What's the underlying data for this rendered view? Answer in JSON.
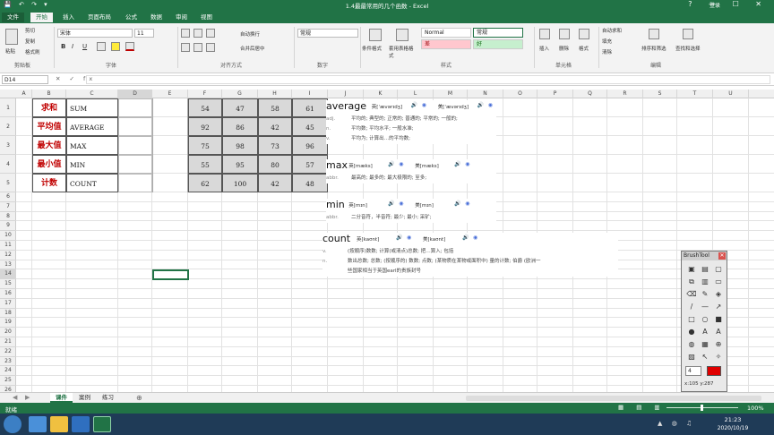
{
  "window": {
    "title": "1.4最最常用的几个函数 - Excel",
    "user": "登录",
    "controls": [
      "?",
      "—",
      "☐",
      "✕"
    ]
  },
  "quick_access": [
    "💾",
    "↶",
    "↷",
    "▾"
  ],
  "ribbon_tabs": [
    "文件",
    "开始",
    "插入",
    "页面布局",
    "公式",
    "数据",
    "审阅",
    "视图"
  ],
  "ribbon": {
    "clipboard": {
      "paste": "粘贴",
      "cut": "剪切",
      "copy": "复制",
      "format_painter": "格式刷",
      "label": "剪贴板"
    },
    "font": {
      "name": "宋体",
      "size": "11",
      "label": "字体",
      "bold": "B",
      "italic": "I",
      "underline": "U"
    },
    "alignment": {
      "wrap": "自动换行",
      "merge": "合并后居中",
      "label": "对齐方式"
    },
    "number": {
      "format": "常规",
      "label": "数字"
    },
    "styles": {
      "conditional": "条件格式",
      "table": "套用表格格式",
      "normal": "Normal",
      "general": "常规",
      "bad": "差",
      "good": "好",
      "label": "样式"
    },
    "cells": {
      "insert": "插入",
      "delete": "删除",
      "format": "格式",
      "label": "单元格"
    },
    "editing": {
      "autosum": "自动求和",
      "fill": "填充",
      "clear": "清除",
      "sort": "排序和筛选",
      "find": "查找和选择",
      "label": "编辑"
    }
  },
  "namebox": "D14",
  "fx": "✕ ✓ fx",
  "columns": [
    "A",
    "B",
    "C",
    "D",
    "E",
    "F",
    "G",
    "H",
    "I",
    "J",
    "K",
    "L",
    "M",
    "N",
    "O",
    "P",
    "Q",
    "R",
    "S",
    "T",
    "U"
  ],
  "rows": [
    "1",
    "2",
    "3",
    "4",
    "5",
    "6",
    "7",
    "8",
    "9",
    "10",
    "11",
    "12",
    "13",
    "14",
    "15",
    "16",
    "17",
    "18",
    "19",
    "20",
    "21",
    "22",
    "23",
    "24",
    "25",
    "26",
    "27",
    "28",
    "29"
  ],
  "table": [
    {
      "label": "求和",
      "func": "SUM",
      "nums": [
        "54",
        "47",
        "58",
        "61"
      ]
    },
    {
      "label": "平均值",
      "func": "AVERAGE",
      "nums": [
        "92",
        "86",
        "42",
        "45"
      ]
    },
    {
      "label": "最大值",
      "func": "MAX",
      "nums": [
        "75",
        "98",
        "73",
        "96"
      ]
    },
    {
      "label": "最小值",
      "func": "MIN",
      "nums": [
        "55",
        "95",
        "80",
        "57"
      ]
    },
    {
      "label": "计数",
      "func": "COUNT",
      "nums": [
        "62",
        "100",
        "42",
        "48"
      ]
    }
  ],
  "dict": [
    {
      "word": "average",
      "uk": "英[ˈævərɪdʒ]",
      "us": "美[ˈævərɪdʒ]",
      "defs": [
        {
          "pos": "adj.",
          "text": "平均的; 典型的; 正常的; 普通的; 平常的; 一般的;"
        },
        {
          "pos": "n.",
          "text": "平均数; 平均水平; 一般水准;"
        },
        {
          "pos": "v.",
          "text": "平均为; 计算出…的平均数;"
        }
      ]
    },
    {
      "word": "max",
      "uk": "英[mæks]",
      "us": "美[mæks]",
      "defs": [
        {
          "pos": "abbr.",
          "text": "最高的; 最多的; 最大极限的; 至多;"
        }
      ]
    },
    {
      "word": "min",
      "uk": "英[mɪn]",
      "us": "美[mɪn]",
      "defs": [
        {
          "pos": "abbr.",
          "text": "二分音符，半音符; 最少; 最小; 采矿;"
        }
      ]
    },
    {
      "word": "count",
      "uk": "英[kaʊnt]",
      "us": "美[kaʊnt]",
      "defs": [
        {
          "pos": "v.",
          "text": "(按顺序)数数; 计算(或清点)总数; 把…算入; 包括"
        },
        {
          "pos": "n.",
          "text": "数出总数; 总数; (按顺序的) 数数; 点数; (某物质在某物或面积中) 量的计数; 伯爵 (欧洲一"
        },
        {
          "pos": "",
          "text": "些国家相当于英国earl的贵族封号"
        }
      ]
    }
  ],
  "brush": {
    "title": "BrushTool",
    "close": "✕",
    "size": "4",
    "coords": "x:105  y:287"
  },
  "sheets": [
    "课件",
    "案例",
    "练习"
  ],
  "add_sheet": "⊕",
  "status": {
    "ready": "就绪",
    "zoom": "100%"
  },
  "clock": {
    "time": "21:23",
    "date": "2020/10/19"
  },
  "colors": {
    "excel_green": "#217346",
    "label_red": "#c00000",
    "num_gray": "#d9d9d9"
  }
}
